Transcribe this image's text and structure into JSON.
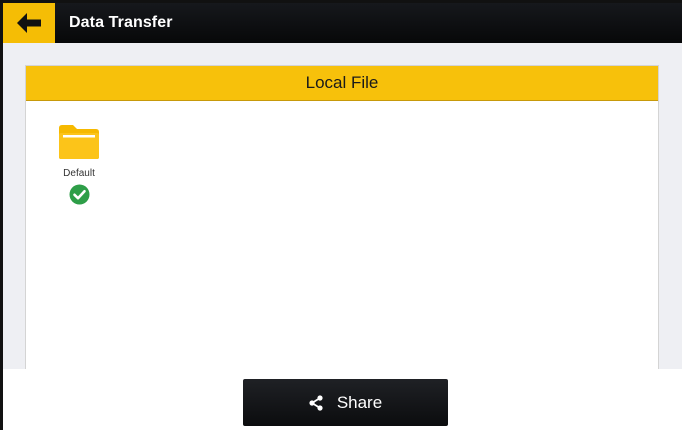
{
  "app_bar": {
    "back_icon": "arrow-left-icon",
    "title": "Data Transfer"
  },
  "panel": {
    "title": "Local File",
    "header_color": "#f7c10b"
  },
  "files": [
    {
      "name": "Default",
      "icon": "folder-icon",
      "selected": true,
      "status_icon": "check-circle-icon"
    }
  ],
  "actions": {
    "share_label": "Share",
    "share_icon": "share-icon"
  },
  "colors": {
    "accent": "#f5bd05",
    "toolbar": "#0b0c0e",
    "success": "#2e9e48"
  }
}
